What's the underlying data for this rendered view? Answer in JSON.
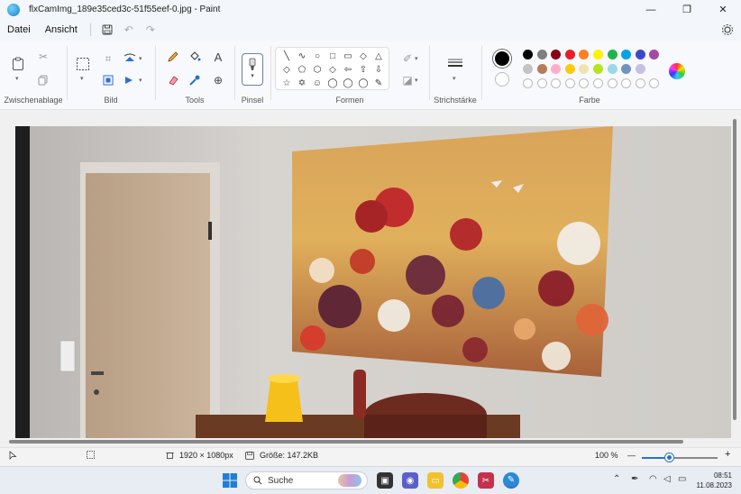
{
  "window": {
    "title": "flxCamImg_189e35ced3c-51f55eef-0.jpg - Paint",
    "minimize_glyph": "—",
    "maximize_glyph": "❐",
    "close_glyph": "✕"
  },
  "menu": {
    "file": "Datei",
    "view": "Ansicht"
  },
  "ribbon": {
    "groups": {
      "clipboard": "Zwischenablage",
      "image": "Bild",
      "tools": "Tools",
      "brush": "Pinsel",
      "shapes": "Formen",
      "stroke": "Strichstärke",
      "color": "Farbe"
    },
    "tool_glyphs": {
      "text": "A",
      "magnifier": "⊕"
    },
    "shape_glyphs": [
      "╲",
      "∿",
      "○",
      "□",
      "▭",
      "◇",
      "△",
      "◇",
      "⬠",
      "⬡",
      "◇",
      "⇦",
      "⇧",
      "⇩",
      "☆",
      "✡",
      "☺",
      "◯",
      "◯",
      "◯",
      "✎"
    ],
    "palette_row1": [
      "#000000",
      "#7f7f7f",
      "#880015",
      "#ed1c24",
      "#ff7f27",
      "#fff200",
      "#22b14c",
      "#00a2e8",
      "#3f48cc",
      "#a349a4"
    ],
    "palette_row2": [
      "#c3c3c3",
      "#b97a57",
      "#ffaec9",
      "#ffc90e",
      "#efe4b0",
      "#b5e61d",
      "#99d9ea",
      "#7092be",
      "#c8bfe7"
    ],
    "primary_color": "#000000",
    "secondary_color": "#ffffff"
  },
  "status": {
    "dimensions": "1920 × 1080px",
    "size": "Größe: 147.2KB",
    "zoom": "100 %",
    "zoom_level": 0.37
  },
  "taskbar": {
    "search_placeholder": "Suche",
    "time": "08:51",
    "date": "11.08.2023"
  }
}
